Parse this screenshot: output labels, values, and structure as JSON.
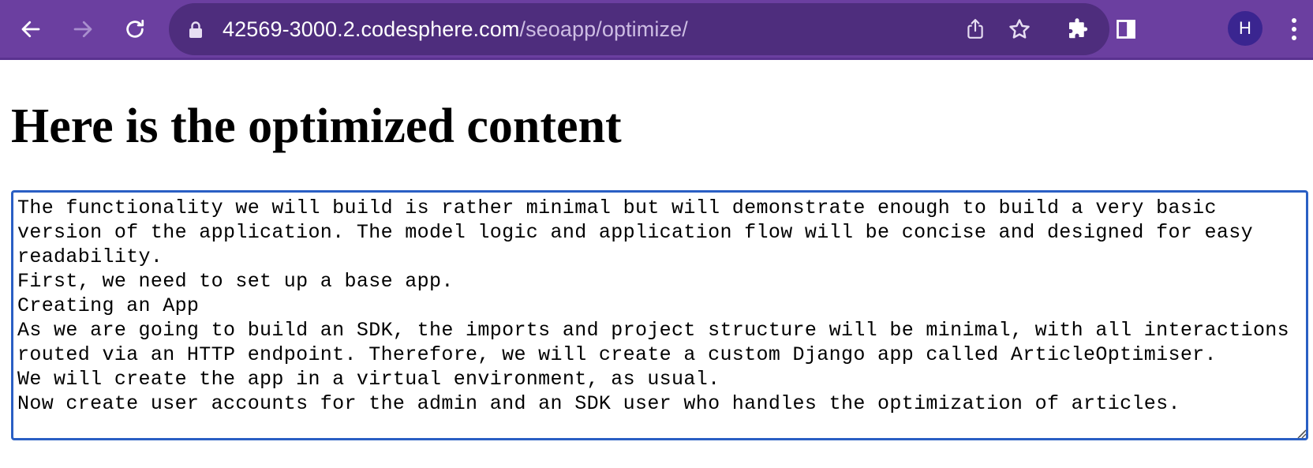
{
  "browser": {
    "url_host": "42569-3000.2.codesphere.com",
    "url_path": "/seoapp/optimize/",
    "profile_initial": "H",
    "toolbar_color": "#6b3fa0",
    "omnibox_color": "#4e2d7d",
    "icons": [
      "back-arrow-icon",
      "forward-arrow-icon",
      "reload-icon",
      "lock-icon",
      "share-icon",
      "star-icon",
      "extensions-icon",
      "side-panel-icon",
      "kebab-menu-icon"
    ]
  },
  "page": {
    "title": "Here is the optimized content",
    "content": "The functionality we will build is rather minimal but will demonstrate enough to build a very basic version of the application. The model logic and application flow will be concise and designed for easy readability.\nFirst, we need to set up a base app.\nCreating an App\nAs we are going to build an SDK, the imports and project structure will be minimal, with all interactions routed via an HTTP endpoint. Therefore, we will create a custom Django app called ArticleOptimiser.\nWe will create the app in a virtual environment, as usual.\nNow create user accounts for the admin and an SDK user who handles the optimization of articles.",
    "textarea_border_color": "#2a5fc4"
  }
}
